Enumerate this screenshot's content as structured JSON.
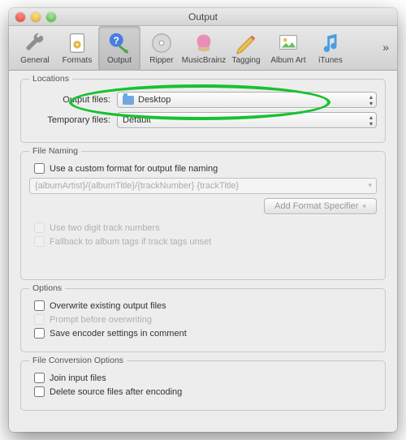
{
  "window": {
    "title": "Output"
  },
  "toolbar": {
    "items": [
      {
        "label": "General"
      },
      {
        "label": "Formats"
      },
      {
        "label": "Output"
      },
      {
        "label": "Ripper"
      },
      {
        "label": "MusicBrainz"
      },
      {
        "label": "Tagging"
      },
      {
        "label": "Album Art"
      },
      {
        "label": "iTunes"
      }
    ],
    "overflow": "»"
  },
  "locations": {
    "title": "Locations",
    "outputLabel": "Output files:",
    "outputValue": "Desktop",
    "tempLabel": "Temporary files:",
    "tempValue": "Default"
  },
  "naming": {
    "title": "File Naming",
    "useCustom": "Use a custom format for output file naming",
    "pattern": "{albumArtist}/{albumTitle}/{trackNumber} {trackTitle}",
    "addSpecifier": "Add Format Specifier",
    "twoDigit": "Use two digit track numbers",
    "fallback": "Fallback to album tags if track tags unset"
  },
  "options": {
    "title": "Options",
    "overwrite": "Overwrite existing output files",
    "prompt": "Prompt before overwriting",
    "saveEncoder": "Save encoder settings in comment"
  },
  "convert": {
    "title": "File Conversion Options",
    "join": "Join input files",
    "delete": "Delete source files after encoding"
  }
}
